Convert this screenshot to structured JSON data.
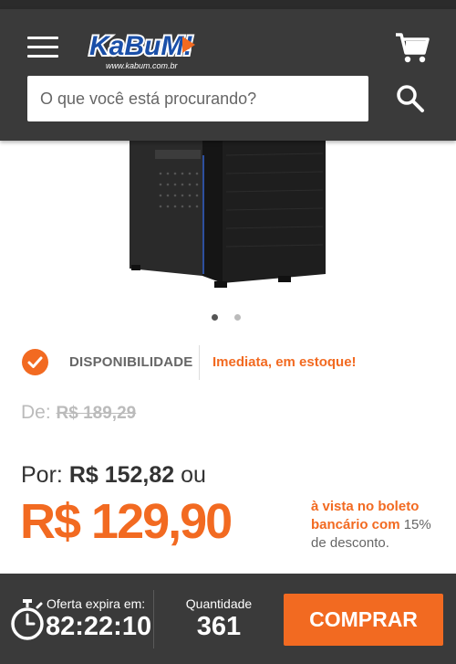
{
  "header": {
    "logo_text": "KaBuM!",
    "logo_url_text": "www.kabum.com.br",
    "search_placeholder": "O que você está procurando?"
  },
  "gallery": {
    "total_images": 2,
    "active_index": 0
  },
  "availability": {
    "label": "DISPONIBILIDADE",
    "status": "Imediata, em estoque!"
  },
  "pricing": {
    "old_prefix": "De:",
    "old_price": "R$ 189,29",
    "por_prefix": "Por:",
    "por_price": "R$ 152,82",
    "por_suffix": "ou",
    "main_price": "R$ 129,90",
    "boleto_highlight": "à vista no boleto bancário com",
    "boleto_percent": "15%",
    "boleto_rest": "de desconto."
  },
  "footer": {
    "expire_label": "Oferta expira em:",
    "expire_time": "82:22:10",
    "qty_label": "Quantidade",
    "qty_value": "361",
    "buy_label": "COMPRAR"
  },
  "colors": {
    "accent": "#f26a21",
    "header_bg": "#3a3a3a",
    "logo_blue": "#1a4fa8"
  }
}
